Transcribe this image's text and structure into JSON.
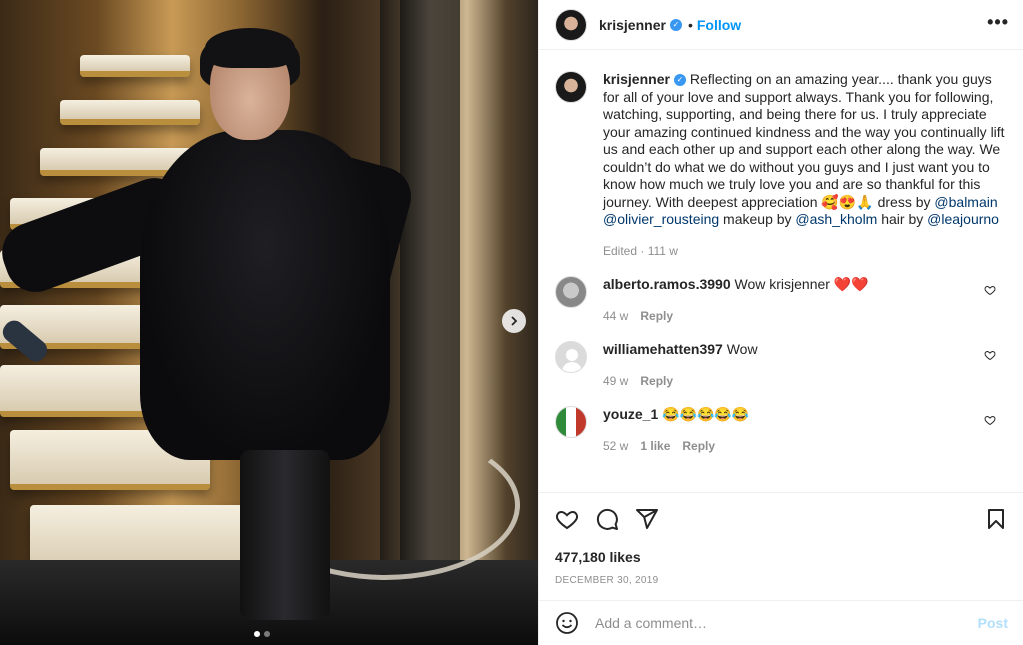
{
  "post": {
    "username": "krisjenner",
    "follow_label": "Follow",
    "separator": "•",
    "more_label": "•••"
  },
  "caption": {
    "username": "krisjenner",
    "text": "Reflecting on an amazing year.... thank you guys for all of your love and support always. Thank you for following, watching, supporting, and being there for us. I truly appreciate your amazing continued kindness and the way you continually lift us and each other up and support each other along the way. We couldn’t do what we do without you guys and I just want you to know how much we truly love you and are so thankful for this journey. With deepest appreciation 🥰😍🙏 dress by ",
    "mention1": "@balmain",
    "mention2": "@olivier_rousteing",
    "mid1": " makeup by ",
    "mention3": "@ash_kholm",
    "mid2": " hair by ",
    "mention4": "@leajourno",
    "edited": "Edited · 111 w"
  },
  "comments": [
    {
      "username": "alberto.ramos.3990",
      "text": "Wow krisjenner ❤️❤️",
      "age": "44 w",
      "likes": "",
      "reply": "Reply"
    },
    {
      "username": "williamehatten397",
      "text": "Wow",
      "age": "49 w",
      "likes": "",
      "reply": "Reply"
    },
    {
      "username": "youze_1",
      "text": "😂😂😂😂😂",
      "age": "52 w",
      "likes": "1 like",
      "reply": "Reply"
    }
  ],
  "stats": {
    "likes": "477,180 likes",
    "date": "DECEMBER 30, 2019"
  },
  "add_comment": {
    "placeholder": "Add a comment…",
    "post_label": "Post"
  },
  "carousel": {
    "slide_count": 2,
    "current": 1
  }
}
